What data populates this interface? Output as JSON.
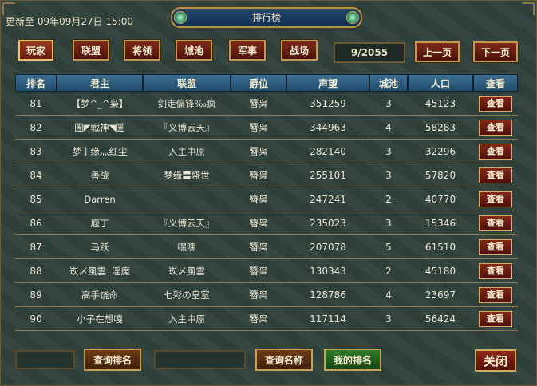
{
  "header": {
    "update_text": "更新至 09年09月27日 15:00",
    "title": "排行榜"
  },
  "tabs": [
    {
      "label": "玩家",
      "active": true
    },
    {
      "label": "联盟",
      "active": false
    },
    {
      "label": "将领",
      "active": false
    },
    {
      "label": "城池",
      "active": false
    },
    {
      "label": "军事",
      "active": false
    },
    {
      "label": "战场",
      "active": false
    }
  ],
  "pagination": {
    "page": "9/2055",
    "prev_label": "上一页",
    "next_label": "下一页"
  },
  "table": {
    "columns": [
      "排名",
      "君主",
      "联盟",
      "爵位",
      "声望",
      "城池",
      "人口",
      "查看"
    ],
    "view_label": "查看",
    "rows": [
      {
        "rank": "81",
        "lord": "【梦^_^枭】",
        "alliance": "剑走偏锋‰疯",
        "title": "簪枭",
        "prestige": "351259",
        "cities": "3",
        "population": "45123"
      },
      {
        "rank": "82",
        "lord": "圐◤戦神◥圐",
        "alliance": "『义博云天』",
        "title": "簪枭",
        "prestige": "344963",
        "cities": "4",
        "population": "58283"
      },
      {
        "rank": "83",
        "lord": "梦丨缘灬红尘",
        "alliance": "入主中原",
        "title": "簪枭",
        "prestige": "282140",
        "cities": "3",
        "population": "32296"
      },
      {
        "rank": "84",
        "lord": "善战",
        "alliance": "梦缘〓盛世",
        "title": "簪枭",
        "prestige": "255101",
        "cities": "3",
        "population": "57820"
      },
      {
        "rank": "85",
        "lord": "Darren",
        "alliance": "",
        "title": "簪枭",
        "prestige": "247241",
        "cities": "2",
        "population": "40770"
      },
      {
        "rank": "86",
        "lord": "庖丁",
        "alliance": "『义博云天』",
        "title": "簪枭",
        "prestige": "235023",
        "cities": "3",
        "population": "15346"
      },
      {
        "rank": "87",
        "lord": "马跃",
        "alliance": "嘿嘿",
        "title": "簪枭",
        "prestige": "207078",
        "cities": "5",
        "population": "61510"
      },
      {
        "rank": "88",
        "lord": "崁〆風雲┆淫魔",
        "alliance": "崁〆風雲",
        "title": "簪枭",
        "prestige": "130343",
        "cities": "2",
        "population": "45180"
      },
      {
        "rank": "89",
        "lord": "高手饶命",
        "alliance": "七彩の皇室",
        "title": "簪枭",
        "prestige": "128786",
        "cities": "4",
        "population": "23697"
      },
      {
        "rank": "90",
        "lord": "小子在想嘎",
        "alliance": "入主中原",
        "title": "簪枭",
        "prestige": "117114",
        "cities": "3",
        "population": "56424"
      }
    ]
  },
  "footer": {
    "query_rank_label": "查询排名",
    "query_name_label": "查询名称",
    "my_rank_label": "我的排名",
    "close_label": "关闭"
  }
}
